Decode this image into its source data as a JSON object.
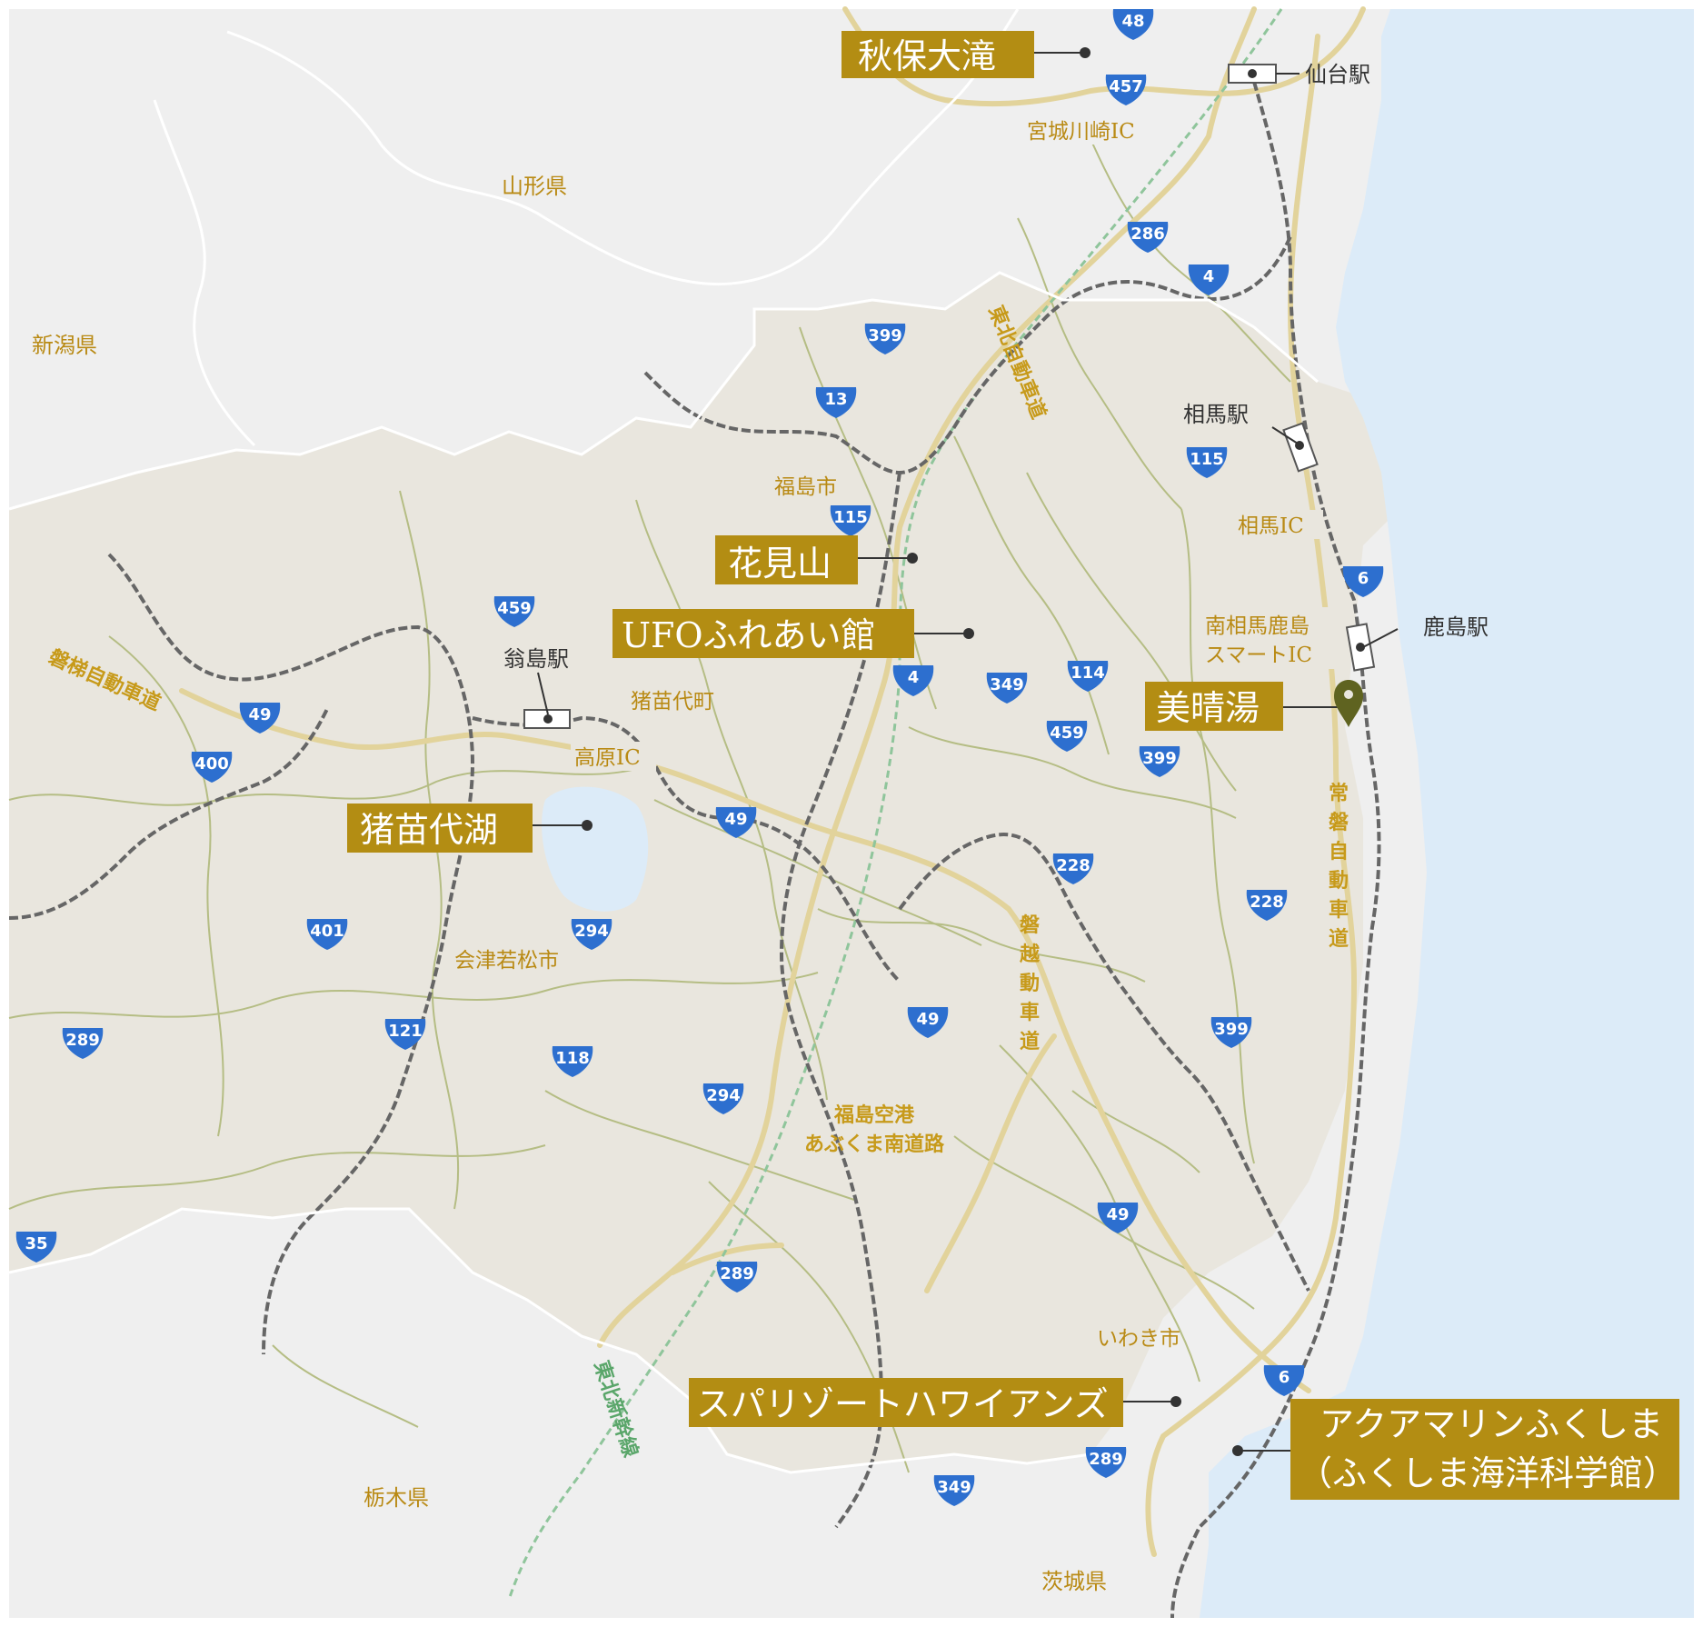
{
  "colors": {
    "sea": "#dcebf8",
    "land_outside": "#efefef",
    "land_fukushima": "#e9e6de",
    "pref_border": "#ffffff",
    "road_minor": "#b5bd84",
    "road_expressway": "#e2d39b",
    "rail": "#666666",
    "shinkansen": "#8fc59b",
    "route_shield": "#2d6fcf",
    "poi_box": "#b38d13",
    "poi_text": "#ffffff",
    "pin": "#5f6320",
    "lake": "#dcebf8"
  },
  "prefectures": [
    {
      "id": "yamagata",
      "label": "山形県"
    },
    {
      "id": "niigata",
      "label": "新潟県"
    },
    {
      "id": "tochigi",
      "label": "栃木県"
    },
    {
      "id": "ibaraki",
      "label": "茨城県"
    }
  ],
  "cities": [
    {
      "id": "fukushima-city",
      "label": "福島市"
    },
    {
      "id": "inawashiro-town",
      "label": "猪苗代町"
    },
    {
      "id": "aizuwakamatsu",
      "label": "会津若松市"
    },
    {
      "id": "iwaki",
      "label": "いわき市"
    }
  ],
  "interchanges": [
    {
      "id": "miyagi-kawasaki-ic",
      "label": "宮城川崎IC"
    },
    {
      "id": "soma-ic",
      "label": "相馬IC"
    },
    {
      "id": "minamisoma-ic-1",
      "label": "南相馬鹿島"
    },
    {
      "id": "minamisoma-ic-2",
      "label": "スマートIC"
    },
    {
      "id": "takahara-ic",
      "label": "高原IC"
    }
  ],
  "stations": [
    {
      "id": "sendai",
      "label": "仙台駅"
    },
    {
      "id": "soma",
      "label": "相馬駅"
    },
    {
      "id": "kashima",
      "label": "鹿島駅"
    },
    {
      "id": "okinajima",
      "label": "翁島駅"
    }
  ],
  "expressways": [
    {
      "id": "tohoku",
      "label": "東北自動車道"
    },
    {
      "id": "bandai",
      "label": "磐梯自動車道"
    },
    {
      "id": "banetsu",
      "label": "磐越自動車道"
    },
    {
      "id": "joban",
      "label": "常磐自動車道"
    },
    {
      "id": "abukuma-1",
      "label": "福島空港"
    },
    {
      "id": "abukuma-2",
      "label": "あぶくま南道路"
    },
    {
      "id": "shinkansen",
      "label": "東北新幹線"
    }
  ],
  "routes": [
    "48",
    "457",
    "286",
    "4",
    "399",
    "13",
    "115",
    "115",
    "6",
    "459",
    "114",
    "349",
    "4",
    "49",
    "400",
    "459",
    "399",
    "49",
    "228",
    "228",
    "401",
    "294",
    "49",
    "399",
    "289",
    "121",
    "118",
    "294",
    "49",
    "35",
    "289",
    "6",
    "289",
    "349"
  ],
  "pois": [
    {
      "id": "akiu-otaki",
      "label": "秋保大滝"
    },
    {
      "id": "hanamiyama",
      "label": "花見山"
    },
    {
      "id": "ufo-fureaikan",
      "label": "UFOふれあい館"
    },
    {
      "id": "biseiyu",
      "label": "美晴湯",
      "highlight": true
    },
    {
      "id": "inawashiro-lake",
      "label": "猪苗代湖"
    },
    {
      "id": "spa-resort-hawaiians",
      "label": "スパリゾートハワイアンズ"
    },
    {
      "id": "aquamarine-1",
      "label": "アクアマリンふくしま"
    },
    {
      "id": "aquamarine-2",
      "label": "（ふくしま海洋科学館）"
    }
  ]
}
